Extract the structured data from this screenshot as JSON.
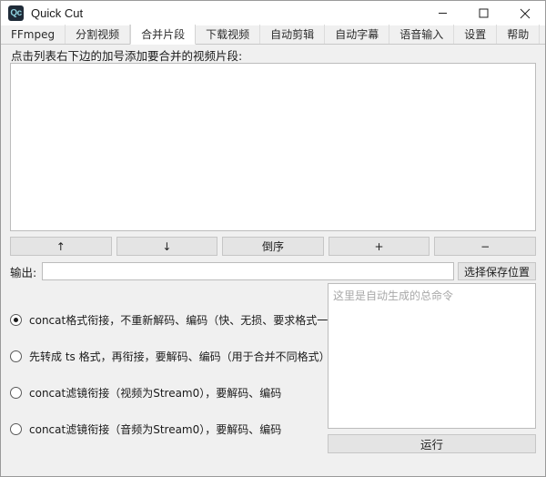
{
  "window": {
    "icon_text": "Qc",
    "icon_name": "app-logo-icon",
    "title": "Quick Cut",
    "controls": {
      "minimize": "minimize-icon",
      "maximize": "maximize-icon",
      "close": "close-icon"
    }
  },
  "tabs": [
    {
      "label": "FFmpeg",
      "active": false
    },
    {
      "label": "分割视频",
      "active": false
    },
    {
      "label": "合并片段",
      "active": true
    },
    {
      "label": "下载视频",
      "active": false
    },
    {
      "label": "自动剪辑",
      "active": false
    },
    {
      "label": "自动字幕",
      "active": false
    },
    {
      "label": "语音输入",
      "active": false
    },
    {
      "label": "设置",
      "active": false
    },
    {
      "label": "帮助",
      "active": false
    }
  ],
  "main": {
    "hint": "点击列表右下边的加号添加要合并的视频片段:",
    "list_items": [],
    "buttons": [
      {
        "label": "↑",
        "name": "move-up-button"
      },
      {
        "label": "↓",
        "name": "move-down-button"
      },
      {
        "label": "倒序",
        "name": "reverse-order-button"
      },
      {
        "label": "+",
        "name": "add-clip-button"
      },
      {
        "label": "−",
        "name": "remove-clip-button"
      }
    ],
    "output": {
      "label": "输出:",
      "value": "",
      "placeholder": "",
      "save_button": "选择保存位置"
    },
    "options": [
      {
        "label": "concat格式衔接，不重新解码、编码（快、无损、要求格式一致）",
        "checked": true
      },
      {
        "label": "先转成 ts 格式，再衔接，要解码、编码（用于合并不同格式）",
        "checked": false
      },
      {
        "label": "concat滤镜衔接（视频为Stream0），要解码、编码",
        "checked": false
      },
      {
        "label": "concat滤镜衔接（音频为Stream0），要解码、编码",
        "checked": false
      }
    ],
    "command": {
      "value": "",
      "placeholder": "这里是自动生成的总命令"
    },
    "run_button": "运行"
  },
  "colors": {
    "window_bg": "#f0f0f0",
    "titlebar_bg": "#ffffff",
    "active_tab_bg": "#ffffff",
    "button_bg": "#e4e4e4",
    "border": "#bcbcbc",
    "icon_bg": "#1f2b38",
    "icon_fg": "#8fd3e0",
    "text": "#1a1a1a",
    "placeholder": "#a8a8a8"
  }
}
